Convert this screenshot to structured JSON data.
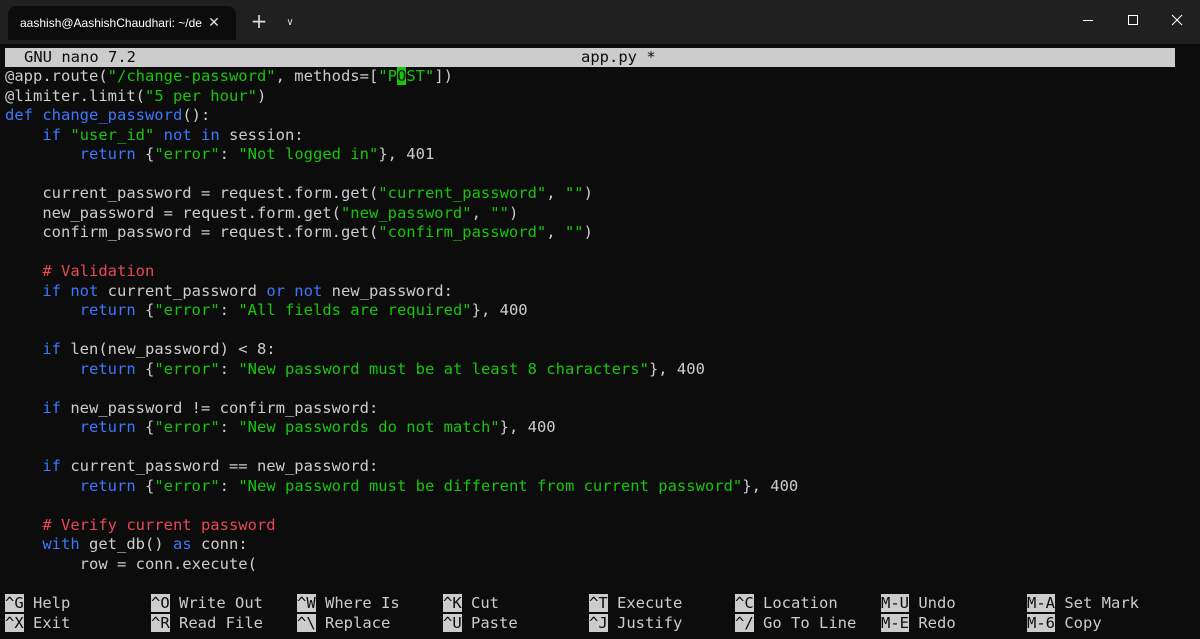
{
  "window": {
    "tab_title": "aashish@AashishChaudhari: ~/de",
    "new_tab_symbol": "+",
    "dropdown_symbol": "∨",
    "close_tab_symbol": "✕"
  },
  "nano": {
    "version": "GNU nano 7.2",
    "filename": "app.py *"
  },
  "editor": {
    "lines": [
      [
        {
          "t": "@app.route(",
          "c": "dec"
        },
        {
          "t": "\"/change-password\"",
          "c": "str"
        },
        {
          "t": ", methods=[",
          "c": "dec"
        },
        {
          "t": "\"P",
          "c": "str"
        },
        {
          "t": "O",
          "c": "cur"
        },
        {
          "t": "ST\"",
          "c": "str"
        },
        {
          "t": "])",
          "c": "dec"
        }
      ],
      [
        {
          "t": "@limiter.limit(",
          "c": "dec"
        },
        {
          "t": "\"5 per hour\"",
          "c": "str"
        },
        {
          "t": ")",
          "c": "dec"
        }
      ],
      [
        {
          "t": "def ",
          "c": "kw"
        },
        {
          "t": "change_password",
          "c": "fn"
        },
        {
          "t": "():",
          "c": "dec"
        }
      ],
      [
        {
          "t": "    ",
          "c": "dec"
        },
        {
          "t": "if ",
          "c": "kw"
        },
        {
          "t": "\"user_id\"",
          "c": "str"
        },
        {
          "t": " not in",
          "c": "kw"
        },
        {
          "t": " session:",
          "c": "dec"
        }
      ],
      [
        {
          "t": "        ",
          "c": "dec"
        },
        {
          "t": "return",
          "c": "kw"
        },
        {
          "t": " {",
          "c": "dec"
        },
        {
          "t": "\"error\"",
          "c": "str"
        },
        {
          "t": ": ",
          "c": "dec"
        },
        {
          "t": "\"Not logged in\"",
          "c": "str"
        },
        {
          "t": "}, 401",
          "c": "dec"
        }
      ],
      [],
      [
        {
          "t": "    current_password = request.form.get(",
          "c": "dec"
        },
        {
          "t": "\"current_password\"",
          "c": "str"
        },
        {
          "t": ", ",
          "c": "dec"
        },
        {
          "t": "\"\"",
          "c": "str"
        },
        {
          "t": ")",
          "c": "dec"
        }
      ],
      [
        {
          "t": "    new_password = request.form.get(",
          "c": "dec"
        },
        {
          "t": "\"new_password\"",
          "c": "str"
        },
        {
          "t": ", ",
          "c": "dec"
        },
        {
          "t": "\"\"",
          "c": "str"
        },
        {
          "t": ")",
          "c": "dec"
        }
      ],
      [
        {
          "t": "    confirm_password = request.form.get(",
          "c": "dec"
        },
        {
          "t": "\"confirm_password\"",
          "c": "str"
        },
        {
          "t": ", ",
          "c": "dec"
        },
        {
          "t": "\"\"",
          "c": "str"
        },
        {
          "t": ")",
          "c": "dec"
        }
      ],
      [],
      [
        {
          "t": "    # Validation",
          "c": "cmt"
        }
      ],
      [
        {
          "t": "    ",
          "c": "dec"
        },
        {
          "t": "if not",
          "c": "kw"
        },
        {
          "t": " current_password ",
          "c": "dec"
        },
        {
          "t": "or not",
          "c": "kw"
        },
        {
          "t": " new_password:",
          "c": "dec"
        }
      ],
      [
        {
          "t": "        ",
          "c": "dec"
        },
        {
          "t": "return",
          "c": "kw"
        },
        {
          "t": " {",
          "c": "dec"
        },
        {
          "t": "\"error\"",
          "c": "str"
        },
        {
          "t": ": ",
          "c": "dec"
        },
        {
          "t": "\"All fields are required\"",
          "c": "str"
        },
        {
          "t": "}, 400",
          "c": "dec"
        }
      ],
      [],
      [
        {
          "t": "    ",
          "c": "dec"
        },
        {
          "t": "if",
          "c": "kw"
        },
        {
          "t": " len(new_password) < 8:",
          "c": "dec"
        }
      ],
      [
        {
          "t": "        ",
          "c": "dec"
        },
        {
          "t": "return",
          "c": "kw"
        },
        {
          "t": " {",
          "c": "dec"
        },
        {
          "t": "\"error\"",
          "c": "str"
        },
        {
          "t": ": ",
          "c": "dec"
        },
        {
          "t": "\"New password must be at least 8 characters\"",
          "c": "str"
        },
        {
          "t": "}, 400",
          "c": "dec"
        }
      ],
      [],
      [
        {
          "t": "    ",
          "c": "dec"
        },
        {
          "t": "if",
          "c": "kw"
        },
        {
          "t": " new_password != confirm_password:",
          "c": "dec"
        }
      ],
      [
        {
          "t": "        ",
          "c": "dec"
        },
        {
          "t": "return",
          "c": "kw"
        },
        {
          "t": " {",
          "c": "dec"
        },
        {
          "t": "\"error\"",
          "c": "str"
        },
        {
          "t": ": ",
          "c": "dec"
        },
        {
          "t": "\"New passwords do not match\"",
          "c": "str"
        },
        {
          "t": "}, 400",
          "c": "dec"
        }
      ],
      [],
      [
        {
          "t": "    ",
          "c": "dec"
        },
        {
          "t": "if",
          "c": "kw"
        },
        {
          "t": " current_password == new_password:",
          "c": "dec"
        }
      ],
      [
        {
          "t": "        ",
          "c": "dec"
        },
        {
          "t": "return",
          "c": "kw"
        },
        {
          "t": " {",
          "c": "dec"
        },
        {
          "t": "\"error\"",
          "c": "str"
        },
        {
          "t": ": ",
          "c": "dec"
        },
        {
          "t": "\"New password must be different from current password\"",
          "c": "str"
        },
        {
          "t": "}, 400",
          "c": "dec"
        }
      ],
      [],
      [
        {
          "t": "    # Verify current password",
          "c": "cmt"
        }
      ],
      [
        {
          "t": "    ",
          "c": "dec"
        },
        {
          "t": "with",
          "c": "kw"
        },
        {
          "t": " get_db() ",
          "c": "dec"
        },
        {
          "t": "as",
          "c": "kw"
        },
        {
          "t": " conn:",
          "c": "dec"
        }
      ],
      [
        {
          "t": "        row = conn.execute(",
          "c": "dec"
        }
      ]
    ]
  },
  "shortcuts": [
    {
      "key": "^G",
      "label": "Help"
    },
    {
      "key": "^X",
      "label": "Exit"
    },
    {
      "key": "^O",
      "label": "Write Out"
    },
    {
      "key": "^R",
      "label": "Read File"
    },
    {
      "key": "^W",
      "label": "Where Is"
    },
    {
      "key": "^\\",
      "label": "Replace"
    },
    {
      "key": "^K",
      "label": "Cut"
    },
    {
      "key": "^U",
      "label": "Paste"
    },
    {
      "key": "^T",
      "label": "Execute"
    },
    {
      "key": "^J",
      "label": "Justify"
    },
    {
      "key": "^C",
      "label": "Location"
    },
    {
      "key": "^/",
      "label": "Go To Line"
    },
    {
      "key": "M-U",
      "label": "Undo"
    },
    {
      "key": "M-E",
      "label": "Redo"
    },
    {
      "key": "M-A",
      "label": "Set Mark"
    },
    {
      "key": "M-6",
      "label": "Copy"
    }
  ]
}
